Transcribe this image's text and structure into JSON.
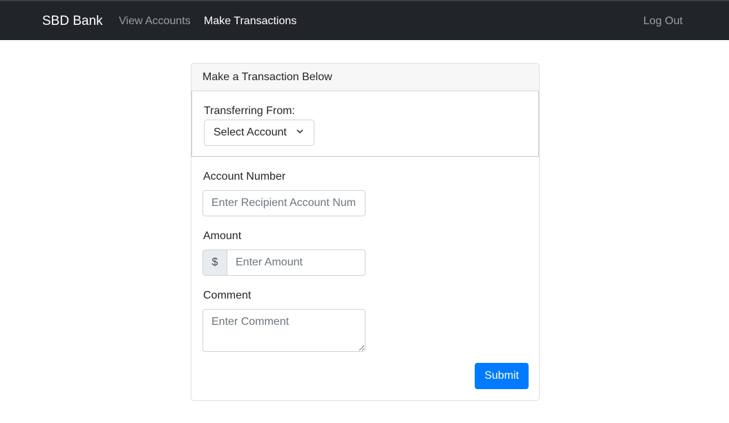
{
  "navbar": {
    "brand": "SBD Bank",
    "links": [
      {
        "label": "View Accounts"
      },
      {
        "label": "Make Transactions"
      }
    ],
    "logout": "Log Out"
  },
  "form": {
    "header": "Make a Transaction Below",
    "from_label": "Transferring From:",
    "from_select": "Select Account",
    "account_label": "Account Number",
    "account_placeholder": "Enter Recipient Account Number",
    "amount_label": "Amount",
    "currency_symbol": "$",
    "amount_placeholder": "Enter Amount",
    "comment_label": "Comment",
    "comment_placeholder": "Enter Comment",
    "submit": "Submit"
  },
  "colors": {
    "navbar_bg": "#212529",
    "primary": "#007bff"
  }
}
